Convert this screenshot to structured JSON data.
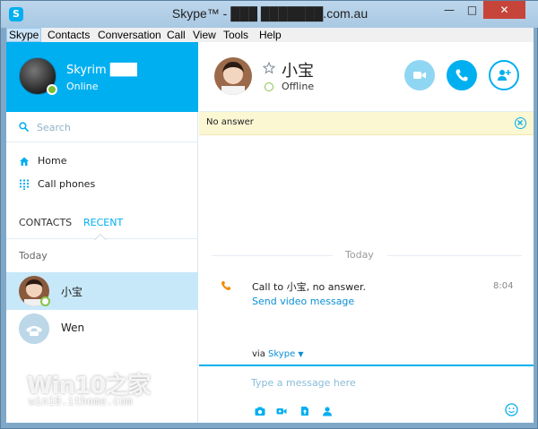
{
  "window": {
    "title": "Skype™ - ███ ███████.com.au",
    "app_icon": "S",
    "controls": {
      "minimize": "—",
      "maximize": "□",
      "close": "✕"
    }
  },
  "menu": [
    "Skype",
    "Contacts",
    "Conversation",
    "Call",
    "View",
    "Tools",
    "Help"
  ],
  "profile": {
    "name": "Skyrim ███",
    "status": "Online"
  },
  "search": {
    "placeholder": "Search"
  },
  "nav": [
    {
      "label": "Home",
      "icon": "home-icon"
    },
    {
      "label": "Call phones",
      "icon": "dialpad-icon"
    }
  ],
  "tabs": {
    "contacts": "CONTACTS",
    "recent": "RECENT",
    "active": "recent"
  },
  "recent": {
    "group": "Today",
    "items": [
      {
        "name": "小宝",
        "selected": true,
        "presence": "offline"
      },
      {
        "name": "Wen",
        "selected": false
      }
    ]
  },
  "conversation": {
    "contact_name": "小宝",
    "contact_status": "Offline",
    "notice": "No answer",
    "day_separator": "Today",
    "event": {
      "text": "Call to 小宝, no answer.",
      "link": "Send video message",
      "time": "8:04"
    },
    "via_label": "via",
    "via_service": "Skype",
    "compose_placeholder": "Type a message here"
  },
  "watermark": {
    "main": "Win10之家",
    "sub": "win10.ithome.com"
  },
  "colors": {
    "accent": "#00aff0",
    "online": "#7cbf33",
    "selected_row": "#c7e8f8",
    "notice_bg": "#fbf7d3"
  }
}
